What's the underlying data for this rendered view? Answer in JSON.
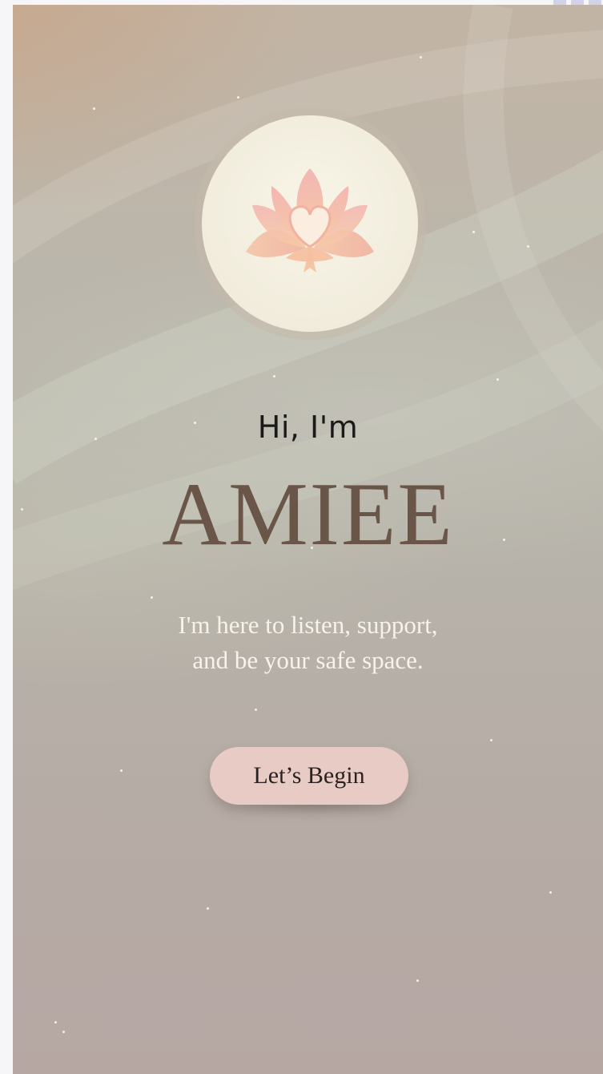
{
  "welcome": {
    "greeting": "Hi, I'm",
    "app_name": "AMIEE",
    "tagline_line1": "I'm here to listen, support,",
    "tagline_line2": "and be your safe space.",
    "cta_label": "Let’s Begin"
  },
  "logo": {
    "icon": "lotus-heart-icon"
  },
  "colors": {
    "title": "#6a5649",
    "greeting": "#1c1a18",
    "tagline": "#f7f3ea",
    "button_bg": "#e8cbc5",
    "button_text": "#2a2220",
    "lotus": "#f2b9ad"
  }
}
